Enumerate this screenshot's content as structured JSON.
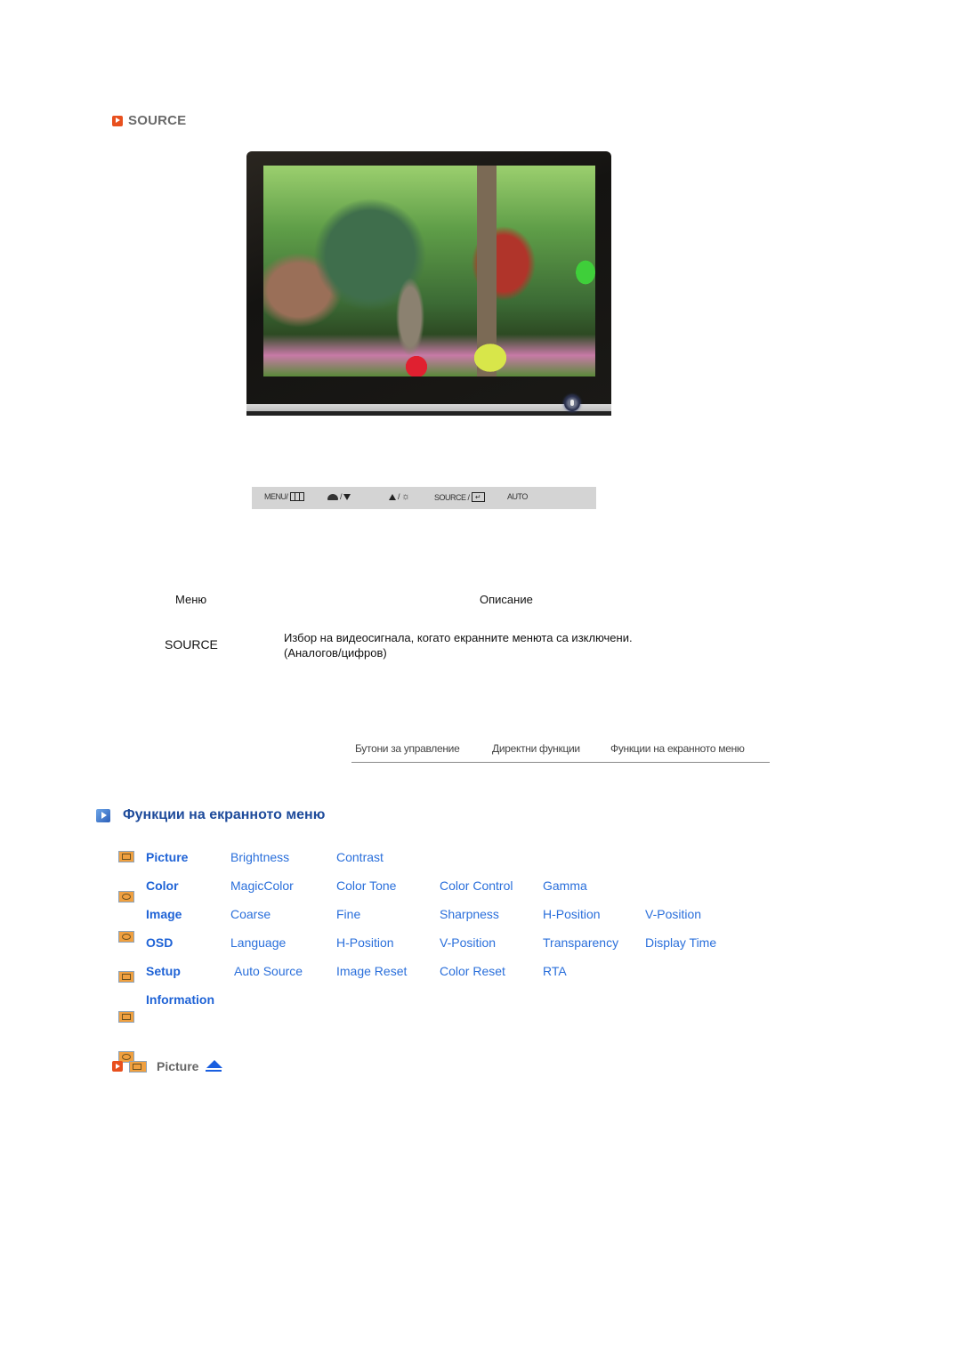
{
  "section": {
    "title": "SOURCE",
    "icon": "orange-play-icon"
  },
  "monitor": {
    "image_description": "Garden scene with stone pagoda, trees and colored lanterns",
    "power_icon": "power-button-icon"
  },
  "control_bar": {
    "items": [
      {
        "label": "MENU/",
        "icon": "menu-grid-icon"
      },
      {
        "label": "/",
        "icon_left": "magicbright-icon",
        "icon_right": "triangle-down-icon"
      },
      {
        "label": "/",
        "icon_left": "triangle-up-icon",
        "icon_right": "brightness-sun-icon"
      },
      {
        "label": "SOURCE /",
        "icon": "enter-icon"
      },
      {
        "label": "AUTO"
      }
    ]
  },
  "table": {
    "headers": [
      "Меню",
      "Описание"
    ],
    "rows": [
      {
        "menu": "SOURCE",
        "description_line1": "Избор на видеосигнала, когато екранните менюта са изключени.",
        "description_line2": "(Аналогов/цифров)"
      }
    ]
  },
  "nav_tabs": [
    "Бутони за управление",
    "Директни функции",
    "Функции на екранното меню"
  ],
  "osd": {
    "title": "Функции на екранното меню",
    "rows": [
      {
        "category": "Picture",
        "icon": "picture-icon",
        "items": [
          "Brightness",
          "Contrast"
        ]
      },
      {
        "category": "Color",
        "icon": "color-icon",
        "items": [
          "MagicColor",
          "Color Tone",
          "Color Control",
          "Gamma"
        ]
      },
      {
        "category": "Image",
        "icon": "image-icon",
        "items": [
          "Coarse",
          "Fine",
          "Sharpness",
          "H-Position",
          "V-Position"
        ]
      },
      {
        "category": "OSD",
        "icon": "osd-icon",
        "items": [
          "Language",
          "H-Position",
          "V-Position",
          "Transparency",
          "Display Time"
        ]
      },
      {
        "category": "Setup",
        "icon": "setup-icon",
        "items": [
          "Auto Source",
          "Image Reset",
          "Color Reset",
          "RTA"
        ]
      },
      {
        "category": "Information",
        "icon": "information-icon",
        "items": []
      }
    ]
  },
  "picture_header": {
    "label": "Picture",
    "top_icon": "back-to-top-icon"
  },
  "colors": {
    "accent_orange": "#e8501e",
    "heading_blue": "#1e4b9b",
    "link_blue": "#2a6fdb",
    "category_blue": "#1f63d6",
    "control_bar_bg": "#d4d4d4"
  }
}
